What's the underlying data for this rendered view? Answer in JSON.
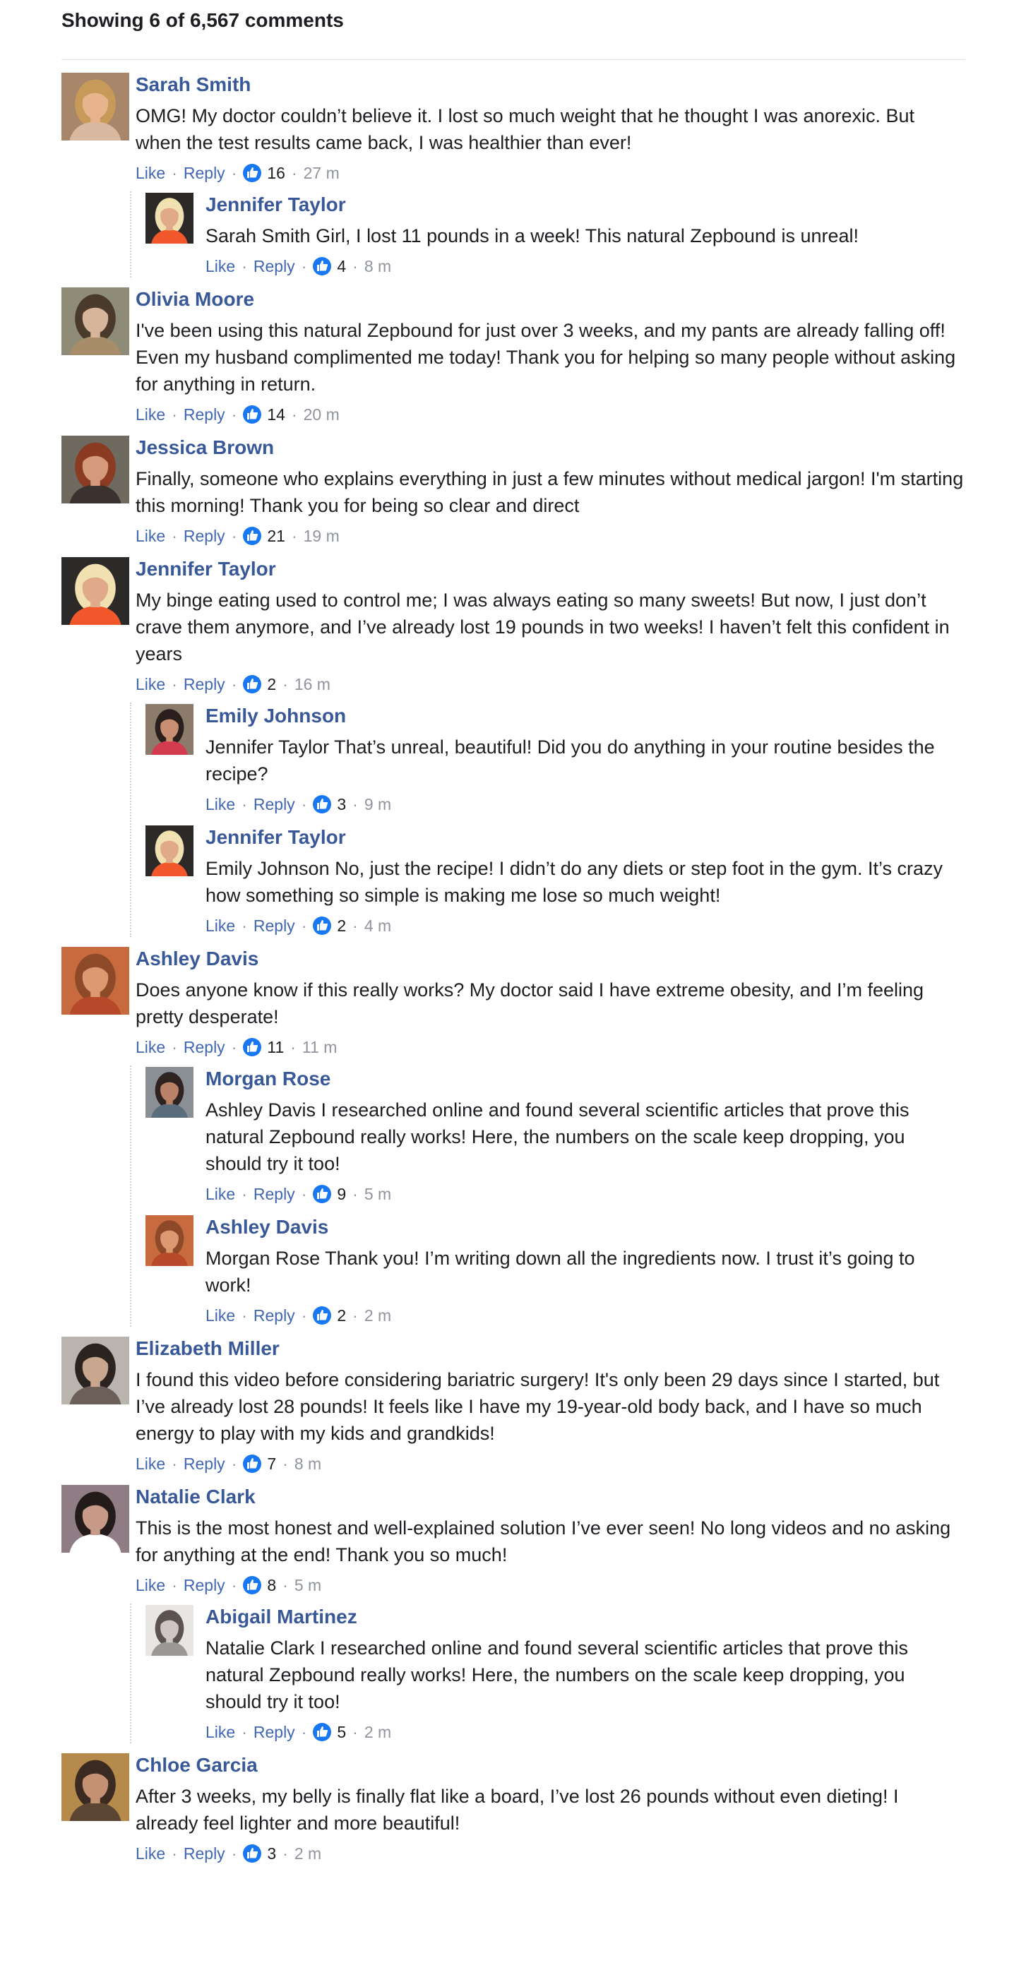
{
  "header": {
    "count_label": "Showing 6 of 6,567 comments"
  },
  "labels": {
    "like": "Like",
    "reply": "Reply",
    "sep": "·"
  },
  "colors": {
    "author": "#385898",
    "link": "#4267b2",
    "like_badge": "#1877f2",
    "meta": "#90949c"
  },
  "threads": [
    {
      "author": "Sarah Smith",
      "text": "OMG! My doctor couldn’t believe it. I lost so much weight that he thought I was anorexic. But when the test results came back, I was healthier than ever!",
      "likes": "16",
      "time": "27 m",
      "avatar": {
        "skin": "#e8b48e",
        "hair": "#c89a5a",
        "bg": "#a7866a",
        "shirt": "#d9b9a0"
      },
      "replies": [
        {
          "author": "Jennifer Taylor",
          "text": "Sarah Smith Girl, I lost 11 pounds in a week! This natural Zepbound is unreal!",
          "likes": "4",
          "time": "8 m",
          "avatar": {
            "skin": "#e0a98a",
            "hair": "#f1e1b0",
            "bg": "#2b2a28",
            "shirt": "#f0572b"
          }
        }
      ]
    },
    {
      "author": "Olivia Moore",
      "text": "I've been using this natural Zepbound for just over 3 weeks, and my pants are already falling off! Even my husband complimented me today! Thank you for helping so many people without asking for anything in return.",
      "likes": "14",
      "time": "20 m",
      "avatar": {
        "skin": "#d7b59a",
        "hair": "#4a3a2c",
        "bg": "#8e8c76",
        "shirt": "#a88d6a"
      },
      "replies": []
    },
    {
      "author": "Jessica Brown",
      "text": "Finally, someone who explains everything in just a few minutes without medical jargon! I'm starting this morning! Thank you for being so clear and direct",
      "likes": "21",
      "time": "19 m",
      "avatar": {
        "skin": "#d59a7c",
        "hair": "#8a3b22",
        "bg": "#6e6a60",
        "shirt": "#3b3230"
      },
      "replies": []
    },
    {
      "author": "Jennifer Taylor",
      "text": "My binge eating used to control me; I was always eating so many sweets! But now, I just don’t crave them anymore, and I’ve already lost 19 pounds in two weeks! I haven’t felt this confident in years",
      "likes": "2",
      "time": "16 m",
      "avatar": {
        "skin": "#e0a98a",
        "hair": "#f1e1b0",
        "bg": "#2b2a28",
        "shirt": "#f0572b"
      },
      "replies": [
        {
          "author": "Emily Johnson",
          "text": "Jennifer Taylor That’s unreal, beautiful! Did you do anything in your routine besides the recipe?",
          "likes": "3",
          "time": "9 m",
          "avatar": {
            "skin": "#c98f72",
            "hair": "#2a1f1c",
            "bg": "#8c7a6b",
            "shirt": "#d23c4e"
          }
        },
        {
          "author": "Jennifer Taylor",
          "text": "Emily Johnson No, just the recipe! I didn’t do any diets or step foot in the gym. It’s crazy how something so simple is making me lose so much weight!",
          "likes": "2",
          "time": "4 m",
          "avatar": {
            "skin": "#e0a98a",
            "hair": "#f1e1b0",
            "bg": "#2b2a28",
            "shirt": "#f0572b"
          }
        }
      ]
    },
    {
      "author": "Ashley Davis",
      "text": "Does anyone know if this really works? My doctor said I have extreme obesity, and I’m feeling pretty desperate!",
      "likes": "11",
      "time": "11 m",
      "avatar": {
        "skin": "#dc9a72",
        "hair": "#8c4a28",
        "bg": "#c76b3e",
        "shirt": "#b6492a"
      },
      "replies": [
        {
          "author": "Morgan Rose",
          "text": "Ashley Davis I researched online and found several scientific articles that prove this natural Zepbound really works! Here, the numbers on the scale keep dropping, you should try it too!",
          "likes": "9",
          "time": "5 m",
          "avatar": {
            "skin": "#b98266",
            "hair": "#2e2320",
            "bg": "#8a8f96",
            "shirt": "#5a6d7c"
          }
        },
        {
          "author": "Ashley Davis",
          "text": "Morgan Rose Thank you! I’m writing down all the ingredients now. I trust it’s going to work!",
          "likes": "2",
          "time": "2 m",
          "avatar": {
            "skin": "#dc9a72",
            "hair": "#8c4a28",
            "bg": "#c76b3e",
            "shirt": "#b6492a"
          }
        }
      ]
    },
    {
      "author": "Elizabeth Miller",
      "text": "I found this video before considering bariatric surgery! It's only been 29 days since I started, but I’ve already lost 28 pounds! It feels like I have my 19-year-old body back, and I have so much energy to play with my kids and grandkids!",
      "likes": "7",
      "time": "8 m",
      "avatar": {
        "skin": "#c9a68e",
        "hair": "#2a2320",
        "bg": "#b9b4ae",
        "shirt": "#6b5f57"
      }
    },
    {
      "author": "Natalie Clark",
      "text": "This is the most honest and well-explained solution I’ve ever seen! No long videos and no asking for anything at the end! Thank you so much!",
      "likes": "8",
      "time": "5 m",
      "avatar": {
        "skin": "#c79a88",
        "hair": "#231a1a",
        "bg": "#8f7c85",
        "shirt": "#ffffff"
      },
      "replies": [
        {
          "author": "Abigail Martinez",
          "text": "Natalie Clark I researched online and found several scientific articles that prove this natural Zepbound really works! Here, the numbers on the scale keep dropping, you should try it too!",
          "likes": "5",
          "time": "2 m",
          "avatar": {
            "skin": "#cfc6c2",
            "hair": "#5b5350",
            "bg": "#e8e6e4",
            "shirt": "#9a9896"
          }
        }
      ]
    },
    {
      "author": "Chloe Garcia",
      "text": "After 3 weeks, my belly is finally flat like a board, I’ve lost 26 pounds without even dieting! I already feel lighter and more beautiful!",
      "likes": "3",
      "time": "2 m",
      "avatar": {
        "skin": "#c49272",
        "hair": "#3a2a22",
        "bg": "#b58a4a",
        "shirt": "#5b4634"
      }
    }
  ]
}
